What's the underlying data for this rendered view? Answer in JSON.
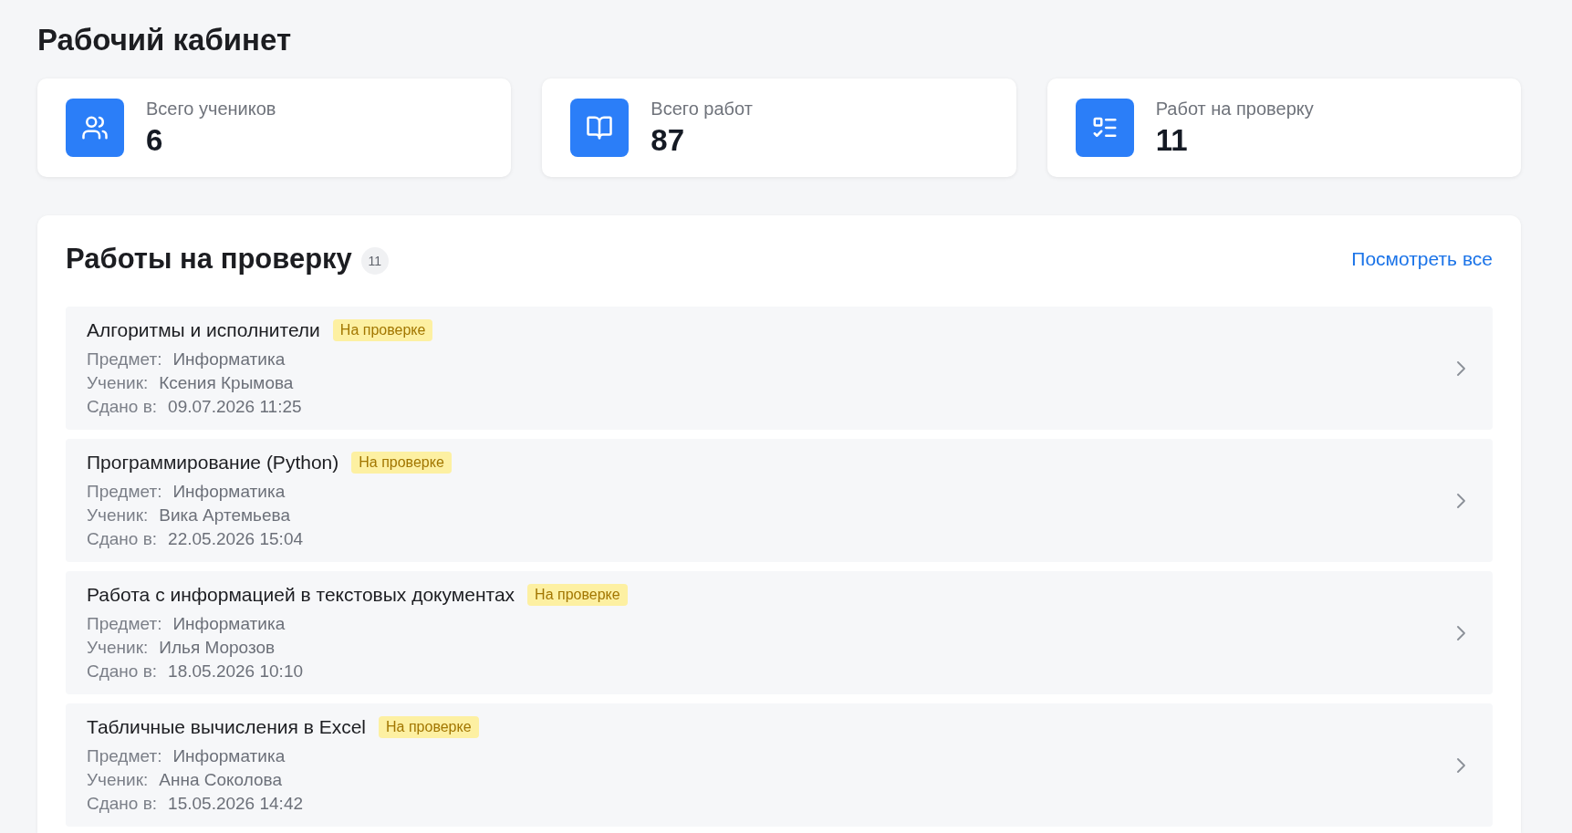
{
  "page": {
    "title": "Рабочий кабинет"
  },
  "stats": [
    {
      "kind": "students",
      "label": "Всего учеников",
      "value": "6"
    },
    {
      "kind": "works",
      "label": "Всего работ",
      "value": "87"
    },
    {
      "kind": "review",
      "label": "Работ на проверку",
      "value": "11"
    }
  ],
  "review_panel": {
    "title": "Работы на проверку",
    "count": "11",
    "link": "Посмотреть все",
    "items": [
      {
        "title": "Алгоритмы и исполнители",
        "status": "На проверке",
        "fields": [
          {
            "label": "Предмет:",
            "value": "Информатика"
          },
          {
            "label": "Ученик:",
            "value": "Ксения Крымова"
          },
          {
            "label": "Сдано в:",
            "value": "09.07.2026 11:25"
          }
        ]
      },
      {
        "title": "Программирование (Python)",
        "status": "На проверке",
        "fields": [
          {
            "label": "Предмет:",
            "value": "Информатика"
          },
          {
            "label": "Ученик:",
            "value": "Вика Артемьева"
          },
          {
            "label": "Сдано в:",
            "value": "22.05.2026 15:04"
          }
        ]
      },
      {
        "title": "Работа с информацией в текстовых документах",
        "status": "На проверке",
        "fields": [
          {
            "label": "Предмет:",
            "value": "Информатика"
          },
          {
            "label": "Ученик:",
            "value": "Илья Морозов"
          },
          {
            "label": "Сдано в:",
            "value": "18.05.2026 10:10"
          }
        ]
      },
      {
        "title": "Табличные вычисления в Excel",
        "status": "На проверке",
        "fields": [
          {
            "label": "Предмет:",
            "value": "Информатика"
          },
          {
            "label": "Ученик:",
            "value": "Анна Соколова"
          },
          {
            "label": "Сдано в:",
            "value": "15.05.2026 14:42"
          }
        ]
      }
    ]
  }
}
